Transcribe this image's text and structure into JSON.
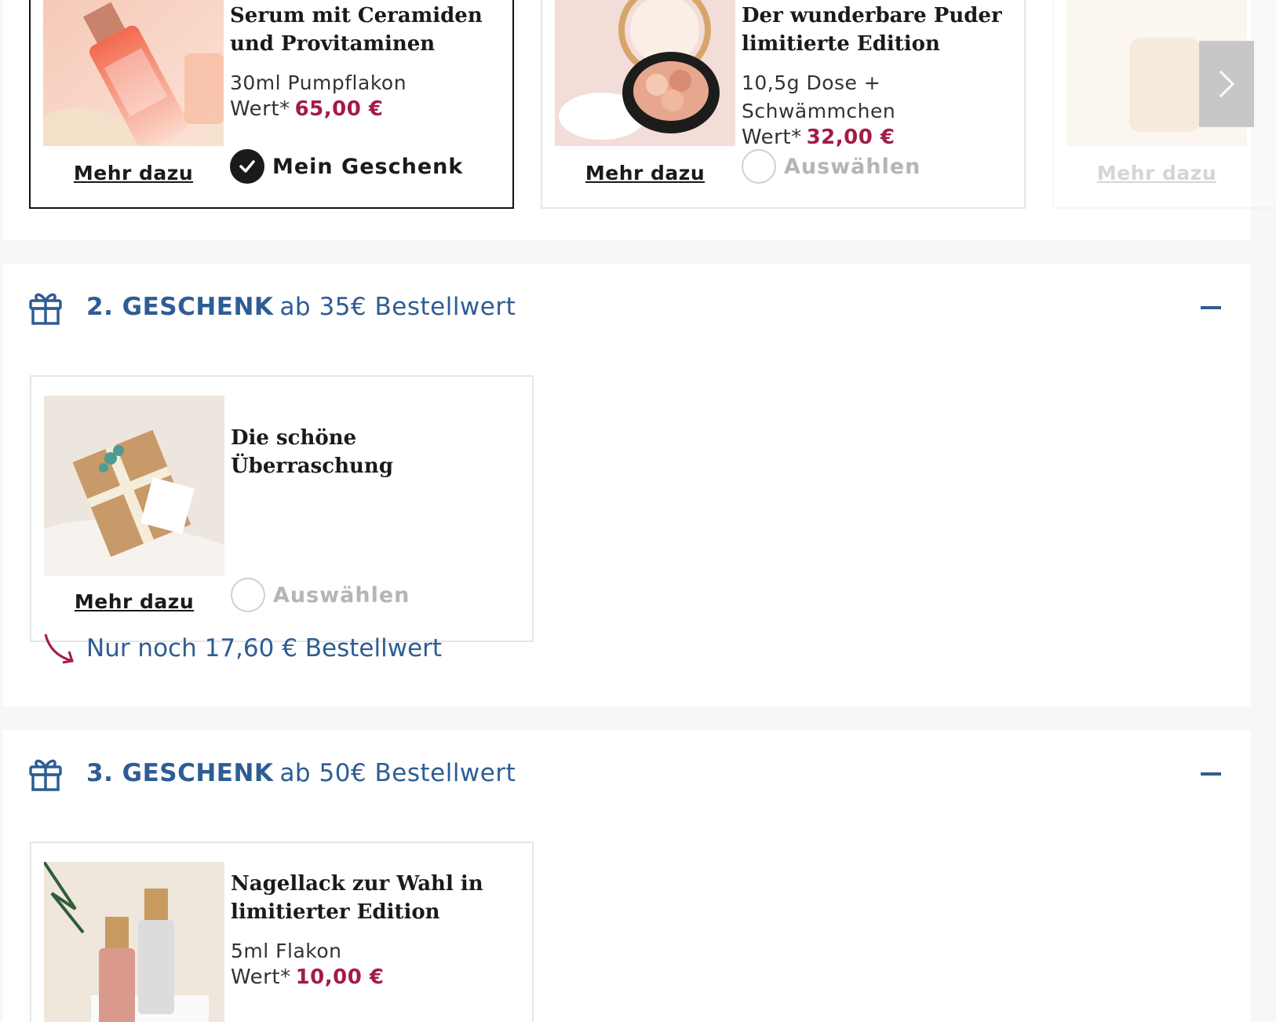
{
  "gift1": {
    "cards": [
      {
        "title": "Serum mit Ceramiden und Provitaminen",
        "desc": "30ml Pumpflakon",
        "price_prefix": "Wert*",
        "price": "65,00 €",
        "more": "Mehr dazu",
        "choice": "Mein Geschenk",
        "selected": true
      },
      {
        "title": "Der wunderbare Puder limitierte Edition",
        "desc": "10,5g Dose + Schwämmchen",
        "price_prefix": "Wert*",
        "price": "32,00 €",
        "more": "Mehr dazu",
        "choice": "Auswählen",
        "selected": false
      },
      {
        "more": "Mehr dazu"
      }
    ]
  },
  "gift2": {
    "number": "2. GESCHENK",
    "threshold": "ab 35€ Bestellwert",
    "card": {
      "title": "Die schöne Überraschung",
      "more": "Mehr dazu",
      "choice": "Auswählen"
    },
    "remaining": "Nur noch 17,60 € Bestellwert"
  },
  "gift3": {
    "number": "3. GESCHENK",
    "threshold": "ab 50€ Bestellwert",
    "card": {
      "title": "Nagellack zur Wahl in limitierter Edition",
      "desc": "5ml Flakon",
      "price_prefix": "Wert*",
      "price": "10,00 €"
    }
  },
  "colors": {
    "accent_blue": "#2e5d94",
    "price_red": "#a31c45"
  },
  "icons": [
    "gift-icon",
    "check-icon",
    "chevron-right-icon",
    "minus-icon",
    "curved-arrow-icon"
  ]
}
